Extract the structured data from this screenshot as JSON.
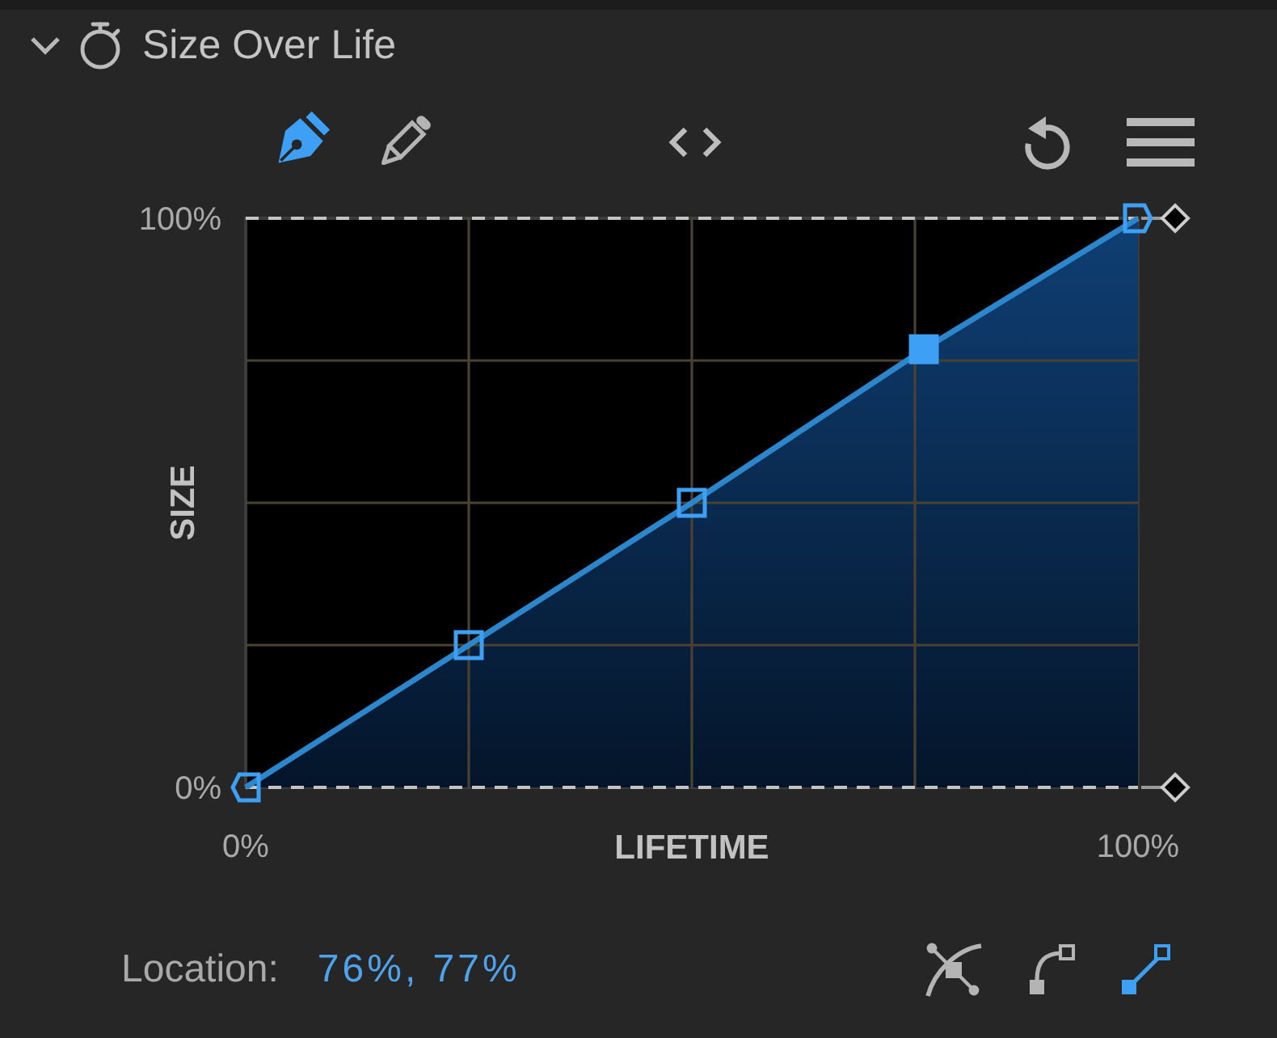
{
  "panel": {
    "title": "Size Over Life",
    "expanded": true
  },
  "toolbar": {
    "tools": [
      {
        "kind": "pen",
        "selected": true
      },
      {
        "kind": "pencil",
        "selected": false
      }
    ]
  },
  "curve": {
    "chart_data": {
      "type": "area",
      "xlabel": "LIFETIME",
      "ylabel": "SIZE",
      "x": [
        0,
        25,
        50,
        76,
        100
      ],
      "series": [
        {
          "color": "#2b86cc",
          "values": [
            0,
            25,
            50,
            77,
            100
          ]
        }
      ],
      "xlim": [
        0,
        100
      ],
      "ylim": [
        0,
        100
      ],
      "xticks": [
        {
          "value": 0,
          "label": "0%"
        },
        {
          "value": 100,
          "label": "100%"
        }
      ],
      "yticks": [
        {
          "value": 0,
          "label": "0%"
        },
        {
          "value": 100,
          "label": "100%"
        }
      ]
    },
    "keyframes": [
      {
        "kind": "start",
        "selected": false
      },
      {
        "kind": "key",
        "selected": false
      },
      {
        "kind": "key",
        "selected": false
      },
      {
        "kind": "key",
        "selected": true
      },
      {
        "kind": "end",
        "selected": false
      }
    ]
  },
  "location": {
    "label": "Location:",
    "value": "76%, 77%"
  },
  "interpolation": [
    {
      "kind": "bezier",
      "selected": false
    },
    {
      "kind": "ease",
      "selected": false
    },
    {
      "kind": "linear",
      "selected": true
    }
  ]
}
